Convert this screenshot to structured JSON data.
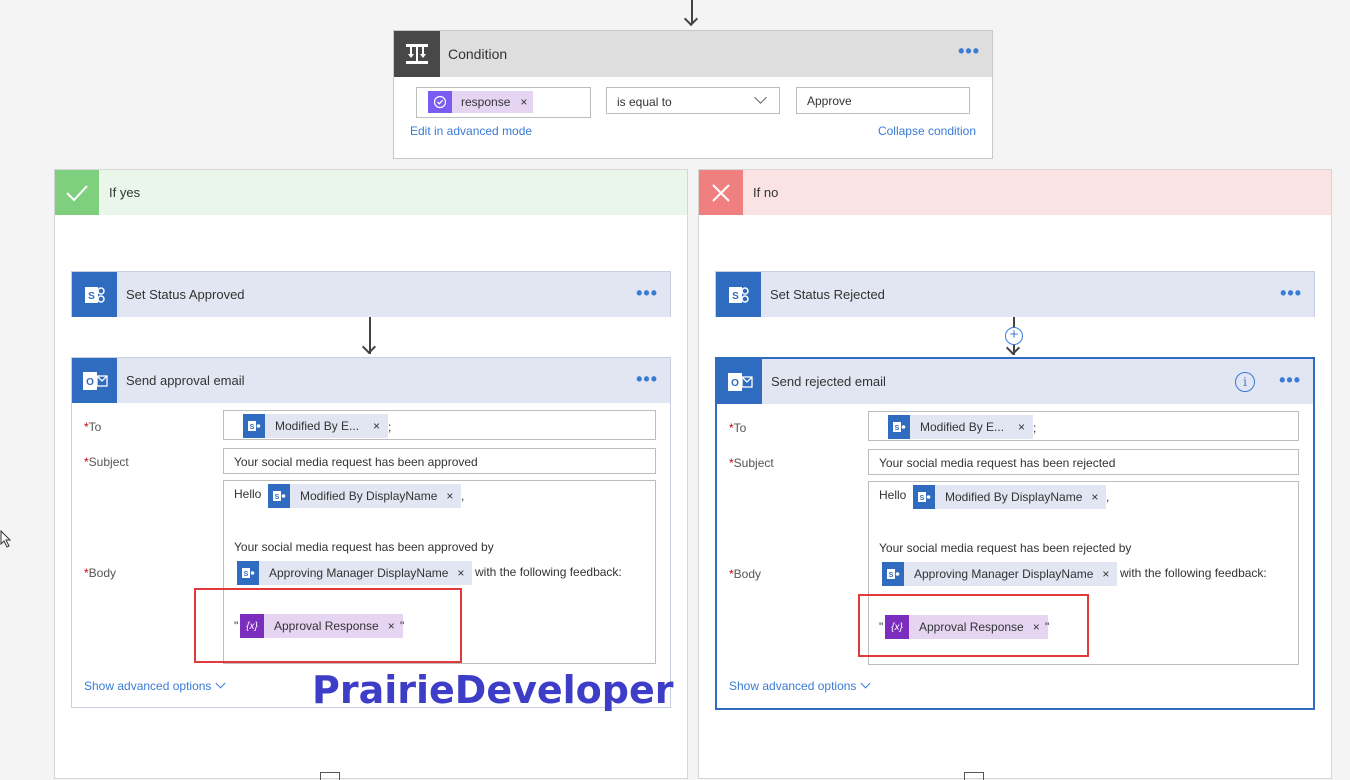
{
  "condition": {
    "title": "Condition",
    "more": "•••",
    "left_token": "response",
    "operator": "is equal to",
    "right_value": "Approve",
    "edit_link": "Edit in advanced mode",
    "collapse_link": "Collapse condition"
  },
  "yes_branch": {
    "title": "If yes",
    "status_action": {
      "title": "Set Status Approved",
      "more": "•••"
    },
    "email_action": {
      "title": "Send approval email",
      "more": "•••",
      "to_label": "To",
      "to_token": "Modified By E...",
      "to_sep": ";",
      "subject_label": "Subject",
      "subject_value": "Your social media request has been approved",
      "body_label": "Body",
      "body_hello": "Hello",
      "body_token1": "Modified By DisplayName",
      "body_comma": ",",
      "body_line2": "Your social media request has been approved by",
      "body_token2": "Approving Manager DisplayName",
      "body_feedback": "with the following feedback:",
      "body_quote_open": "\"",
      "body_token3": "Approval Response",
      "body_quote_close": "\"",
      "advanced": "Show advanced options"
    }
  },
  "no_branch": {
    "title": "If no",
    "status_action": {
      "title": "Set Status Rejected",
      "more": "•••"
    },
    "email_action": {
      "title": "Send rejected email",
      "more": "•••",
      "info": "i",
      "to_label": "To",
      "to_token": "Modified By E...",
      "to_sep": ";",
      "subject_label": "Subject",
      "subject_value": "Your social media request has been rejected",
      "body_label": "Body",
      "body_hello": "Hello",
      "body_token1": "Modified By DisplayName",
      "body_comma": ",",
      "body_line2": "Your social media request has been rejected by",
      "body_token2": "Approving Manager DisplayName",
      "body_feedback": "with the following feedback:",
      "body_quote_open": "\"",
      "body_token3": "Approval Response",
      "body_quote_close": "\"",
      "advanced": "Show advanced options"
    }
  },
  "watermark": "PrairieDeveloper",
  "colors": {
    "accent": "#3a7bd5",
    "sharepoint": "#2f6bbf",
    "variable": "#7b2dbd",
    "yes": "#7ed07e",
    "no": "#f08080",
    "highlight": "#e03a3a"
  }
}
